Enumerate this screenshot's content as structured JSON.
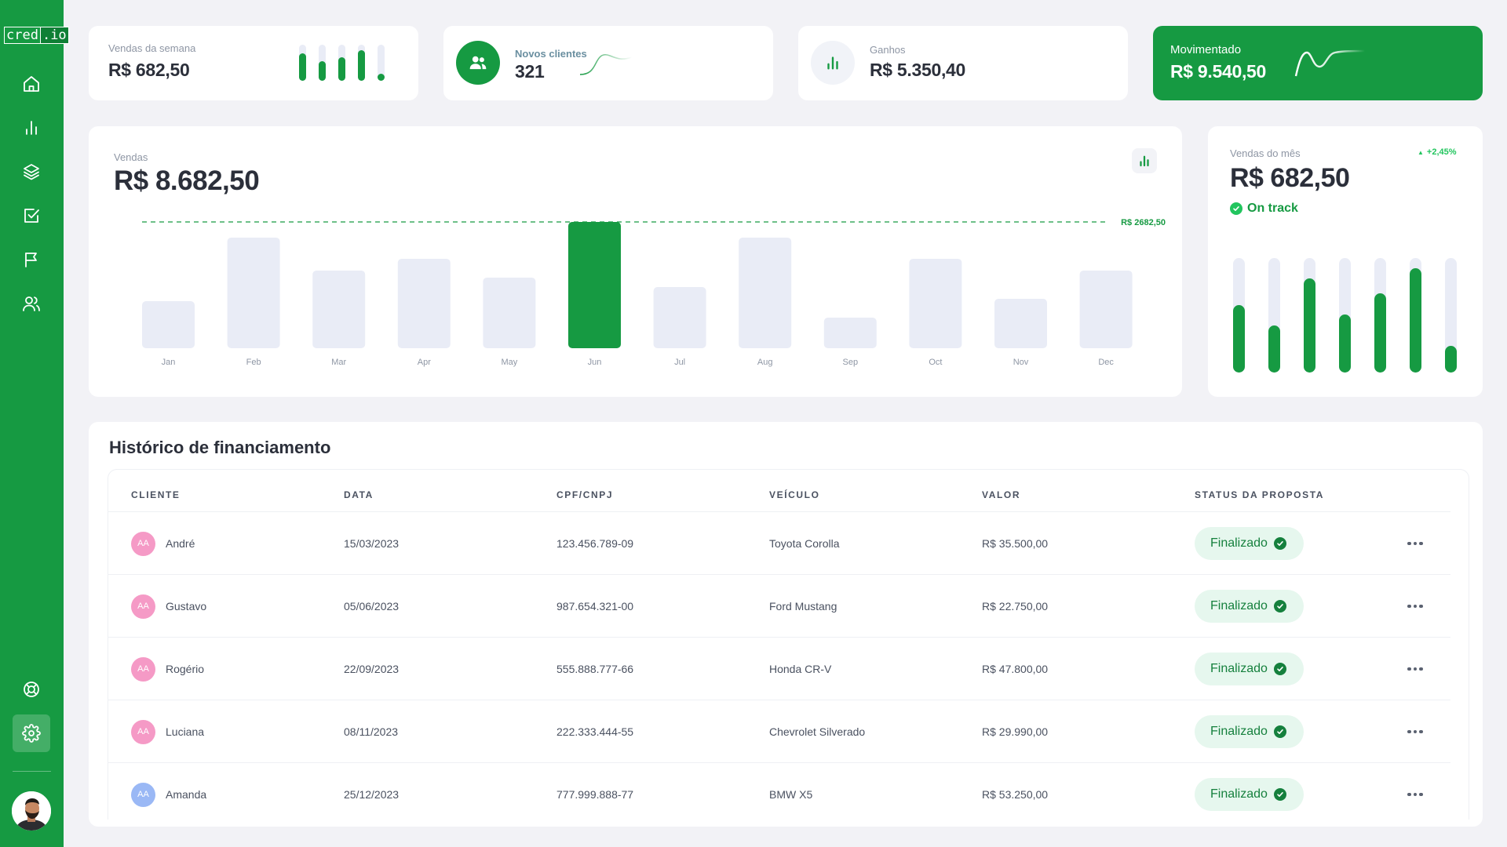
{
  "brand": {
    "left": "cred",
    "right": ".io"
  },
  "colors": {
    "primary": "#169a42",
    "primary_dark": "#0f7f35",
    "bar_inactive": "#e9ecf6",
    "badge_bg": "#e6f7ee",
    "badge_text": "#15803d"
  },
  "sidebar": {
    "items": [
      {
        "icon": "home-icon"
      },
      {
        "icon": "bar-chart-icon"
      },
      {
        "icon": "layers-icon"
      },
      {
        "icon": "checkbox-icon"
      },
      {
        "icon": "flag-icon"
      },
      {
        "icon": "users-icon"
      },
      {
        "icon": "life-buoy-icon"
      },
      {
        "icon": "gear-icon",
        "active": true
      }
    ]
  },
  "stats": {
    "weekly_sales": {
      "label": "Vendas da semana",
      "value": "R$ 682,50",
      "bars": [
        0.75,
        0.55,
        0.65,
        0.85,
        0.2
      ]
    },
    "new_clients": {
      "label": "Novos clientes",
      "value": "321"
    },
    "earnings": {
      "label": "Ganhos",
      "value": "R$ 5.350,40"
    },
    "moved": {
      "label": "Movimentado",
      "value": "R$ 9.540,50"
    }
  },
  "sales_chart": {
    "label": "Vendas",
    "total": "R$ 8.682,50",
    "target_label": "R$ 2682,50"
  },
  "chart_data": {
    "type": "bar",
    "categories": [
      "Jan",
      "Feb",
      "Mar",
      "Apr",
      "May",
      "Jun",
      "Jul",
      "Aug",
      "Sep",
      "Oct",
      "Nov",
      "Dec"
    ],
    "values": [
      1000,
      2350,
      1650,
      1900,
      1500,
      2682.5,
      1300,
      2350,
      650,
      1900,
      1050,
      1650
    ],
    "highlight_index": 5,
    "reference_line": 2682.5,
    "ylim": [
      0,
      2682.5
    ],
    "grid": false
  },
  "monthly": {
    "label": "Vendas do mês",
    "value": "R$ 682,50",
    "change": "+2,45%",
    "status": "On track",
    "bars": [
      0.59,
      0.41,
      0.82,
      0.51,
      0.69,
      0.91,
      0.23
    ]
  },
  "table": {
    "title": "Histórico de financiamento",
    "headers": [
      "CLIENTE",
      "DATA",
      "CPF/CNPJ",
      "VEÍCULO",
      "VALOR",
      "STATUS DA PROPOSTA"
    ],
    "rows": [
      {
        "initials": "AA",
        "avatar_color": "#f59ac6",
        "name": "André",
        "date": "15/03/2023",
        "doc": "123.456.789-09",
        "vehicle": "Toyota Corolla",
        "value": "R$ 35.500,00",
        "status": "Finalizado"
      },
      {
        "initials": "AA",
        "avatar_color": "#f59ac6",
        "name": "Gustavo",
        "date": "05/06/2023",
        "doc": "987.654.321-00",
        "vehicle": "Ford Mustang",
        "value": "R$ 22.750,00",
        "status": "Finalizado"
      },
      {
        "initials": "AA",
        "avatar_color": "#f59ac6",
        "name": "Rogério",
        "date": "22/09/2023",
        "doc": "555.888.777-66",
        "vehicle": "Honda CR-V",
        "value": "R$ 47.800,00",
        "status": "Finalizado"
      },
      {
        "initials": "AA",
        "avatar_color": "#f59ac6",
        "name": "Luciana",
        "date": "08/11/2023",
        "doc": "222.333.444-55",
        "vehicle": "Chevrolet Silverado",
        "value": "R$ 29.990,00",
        "status": "Finalizado"
      },
      {
        "initials": "AA",
        "avatar_color": "#9ab8f5",
        "name": "Amanda",
        "date": "25/12/2023",
        "doc": "777.999.888-77",
        "vehicle": "BMW X5",
        "value": "R$ 53.250,00",
        "status": "Finalizado"
      }
    ]
  }
}
